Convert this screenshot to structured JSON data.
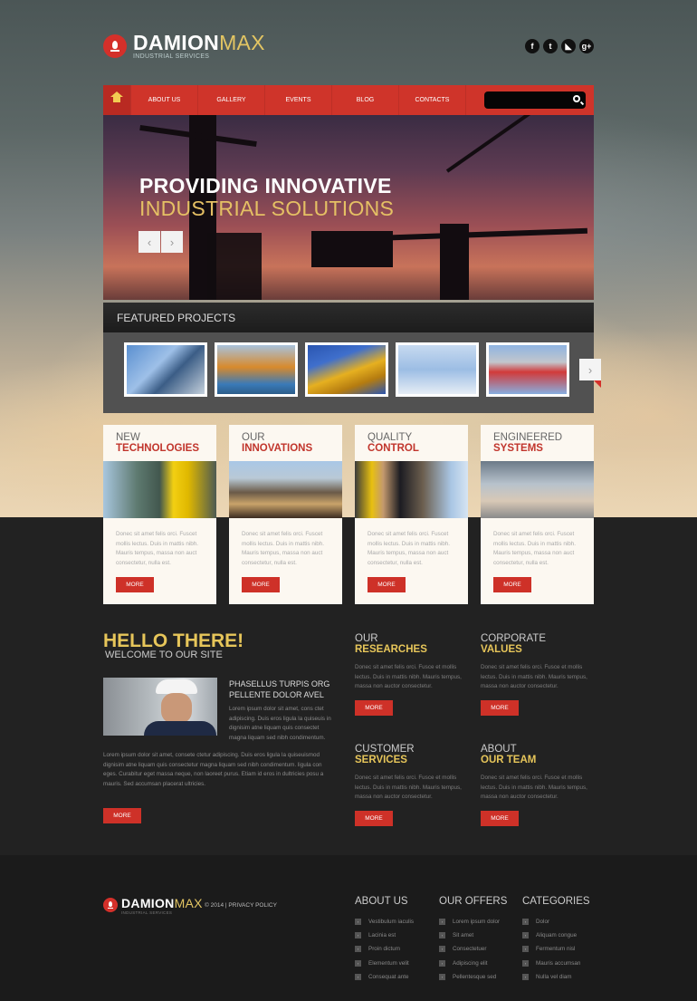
{
  "header": {
    "logo_main": "DAMION",
    "logo_accent": "MAX",
    "logo_tagline": "INDUSTRIAL SERVICES",
    "social": [
      {
        "icon": "facebook-icon",
        "glyph": "f"
      },
      {
        "icon": "twitter-icon",
        "glyph": "t"
      },
      {
        "icon": "rss-icon",
        "glyph": "◣"
      },
      {
        "icon": "google-plus-icon",
        "glyph": "g+"
      }
    ]
  },
  "nav": {
    "home_icon": "home-icon",
    "items": [
      "ABOUT US",
      "GALLERY",
      "EVENTS",
      "BLOG",
      "CONTACTS"
    ],
    "search_placeholder": "",
    "search_value": ""
  },
  "slider": {
    "title_line1": "PROVIDING INNOVATIVE",
    "title_line2": "INDUSTRIAL SOLUTIONS",
    "prev": "‹",
    "next": "›"
  },
  "featured": {
    "title": "FEATURED PROJECTS",
    "thumbnails": [
      "pipeline",
      "dredger",
      "yellow-crane-detail",
      "tower-crane",
      "red-lifting-hook"
    ],
    "next": "›",
    "colors": [
      "#4a7fb8",
      "#d28a2a",
      "#e0a81c",
      "#8bb0d8",
      "#7fa6d6"
    ]
  },
  "cards": [
    {
      "line1": "NEW",
      "line2": "TECHNOLOGIES",
      "text": "Donec sit amet felis orci. Fuscet mollis lectus. Duis in mattis nibh. Mauris tempus, massa non auct consectetur, nulla est.",
      "button": "MORE"
    },
    {
      "line1": "OUR",
      "line2": "INNOVATIONS",
      "text": "Donec sit amet felis orci. Fuscet mollis lectus. Duis in mattis nibh. Mauris tempus, massa non auct consectetur, nulla est.",
      "button": "MORE"
    },
    {
      "line1": "QUALITY",
      "line2": "CONTROL",
      "text": "Donec sit amet felis orci. Fuscet mollis lectus. Duis in mattis nibh. Mauris tempus, massa non auct consectetur, nulla est.",
      "button": "MORE"
    },
    {
      "line1": "ENGINEERED",
      "line2": "SYSTEMS",
      "text": "Donec sit amet felis orci. Fuscet mollis lectus. Duis in mattis nibh. Mauris tempus, massa non auct consectetur, nulla est.",
      "button": "MORE"
    }
  ],
  "welcome": {
    "title": "HELLO THERE!",
    "subtitle": "WELCOME TO OUR SITE",
    "heading_line1": "PHASELLUS TURPIS ORG",
    "heading_line2": "PELLENTE DOLOR AVEL",
    "short_text": "Lorem ipsum dolor sit amet, cons ctet adipiscing. Duis eros ligula la quiseuis in dignisim atne liquam quis consectet magna liquam sed nibh condimentum.",
    "long_text": "Lorem ipsum dolor sit amet, consete ctetur adipiscing. Duis eros ligula la quiseuismod dignisim atne liquam quis consectetur magna liquam sed nibh condimentum. ligula con eges. Curabitur eget massa neque, non laoreet purus. Etiam id eros in dultricies posu a mauris. Sed accumsan placerat ultricies.",
    "button": "MORE"
  },
  "services": [
    {
      "line1": "OUR",
      "line2": "RESEARCHES",
      "text": "Donec sit amet felis orci. Fusce et mollis lectus. Duis in mattis nibh. Mauris tempus, massa non auctor consectetur.",
      "button": "MORE"
    },
    {
      "line1": "CORPORATE",
      "line2": "VALUES",
      "text": "Donec sit amet felis orci. Fusce et mollis lectus. Duis in mattis nibh. Mauris tempus, massa non auctor consectetur.",
      "button": "MORE"
    },
    {
      "line1": "CUSTOMER",
      "line2": "SERVICES",
      "text": "Donec sit amet felis orci. Fusce et mollis lectus. Duis in mattis nibh. Mauris tempus, massa non auctor consectetur.",
      "button": "MORE"
    },
    {
      "line1": "ABOUT",
      "line2": "OUR TEAM",
      "text": "Donec sit amet felis orci. Fusce et mollis lectus. Duis in mattis nibh. Mauris tempus, massa non auctor consectetur.",
      "button": "MORE"
    }
  ],
  "footer": {
    "copyright": "© 2014 | PRIVACY POLICY",
    "columns": [
      {
        "title": "ABOUT US",
        "links": [
          "Vestibulum iaculis",
          "Lacinia est",
          "Proin dictum",
          "Elementum velit",
          "Consequat ante"
        ]
      },
      {
        "title": "OUR OFFERS",
        "links": [
          "Lorem ipsum dolor",
          "Sit amet",
          "Consectetuer",
          "Adipiscing elit",
          "Pellentesque sed"
        ]
      },
      {
        "title": "CATEGORIES",
        "links": [
          "Dolor",
          "Aliquam congue",
          "Fermentum nisl",
          "Mauris accumsan",
          "Nulla vel diam"
        ]
      }
    ]
  },
  "colors": {
    "accent_red": "#cf342a",
    "accent_yellow": "#e7c65a",
    "card_bg": "#fcf8f1",
    "dark_bg": "#222222"
  }
}
